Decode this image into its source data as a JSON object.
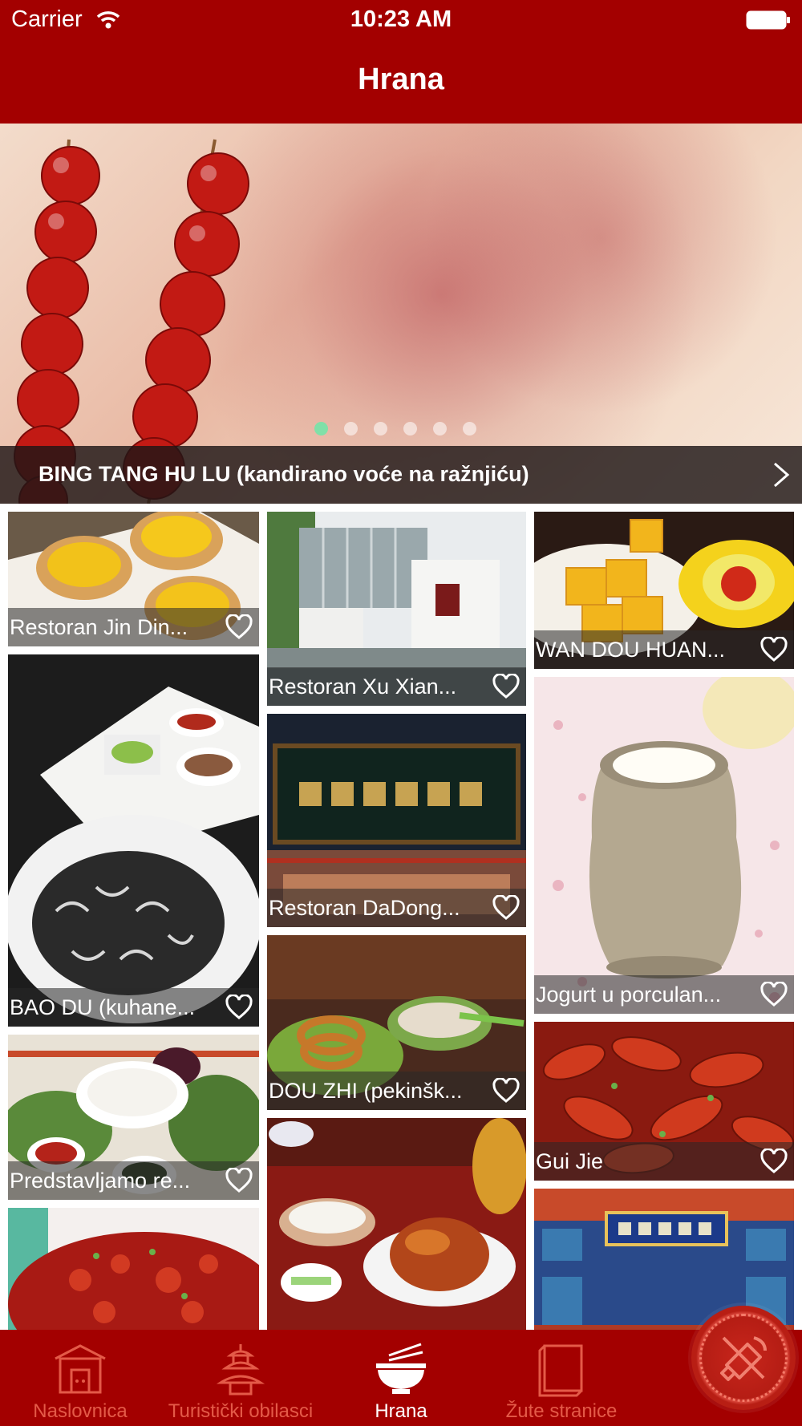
{
  "status_bar": {
    "carrier": "Carrier",
    "time": "10:23 AM"
  },
  "header": {
    "title": "Hrana"
  },
  "hero": {
    "caption": "BING TANG HU LU (kandirano voće na ražnjiću)",
    "page_count": 6,
    "active_page": 1
  },
  "grid": {
    "column1": [
      {
        "label": "Restoran Jin Din..."
      },
      {
        "label": "BAO DU (kuhane..."
      },
      {
        "label": "Predstavljamo re..."
      },
      {
        "label": ""
      }
    ],
    "column2": [
      {
        "label": "Restoran Xu Xian..."
      },
      {
        "label": "Restoran DaDong..."
      },
      {
        "label": "DOU ZHI (pekinšk..."
      },
      {
        "label": ""
      }
    ],
    "column3": [
      {
        "label": "WAN DOU HUAN..."
      },
      {
        "label": "Jogurt u porculan..."
      },
      {
        "label": "Gui Jie"
      },
      {
        "label": ""
      }
    ]
  },
  "tabbar": {
    "tabs": [
      {
        "label": "Naslovnica",
        "icon": "house-icon"
      },
      {
        "label": "Turistički obilasci",
        "icon": "pagoda-icon"
      },
      {
        "label": "Hrana",
        "icon": "bowl-icon",
        "active": true
      },
      {
        "label": "Žute stranice",
        "icon": "book-icon"
      }
    ],
    "fab_icon": "mute-speaker-icon"
  },
  "colors": {
    "brand_red": "#a30000",
    "inactive_tab": "#e45a48",
    "active_dot": "#7fe0a8"
  }
}
